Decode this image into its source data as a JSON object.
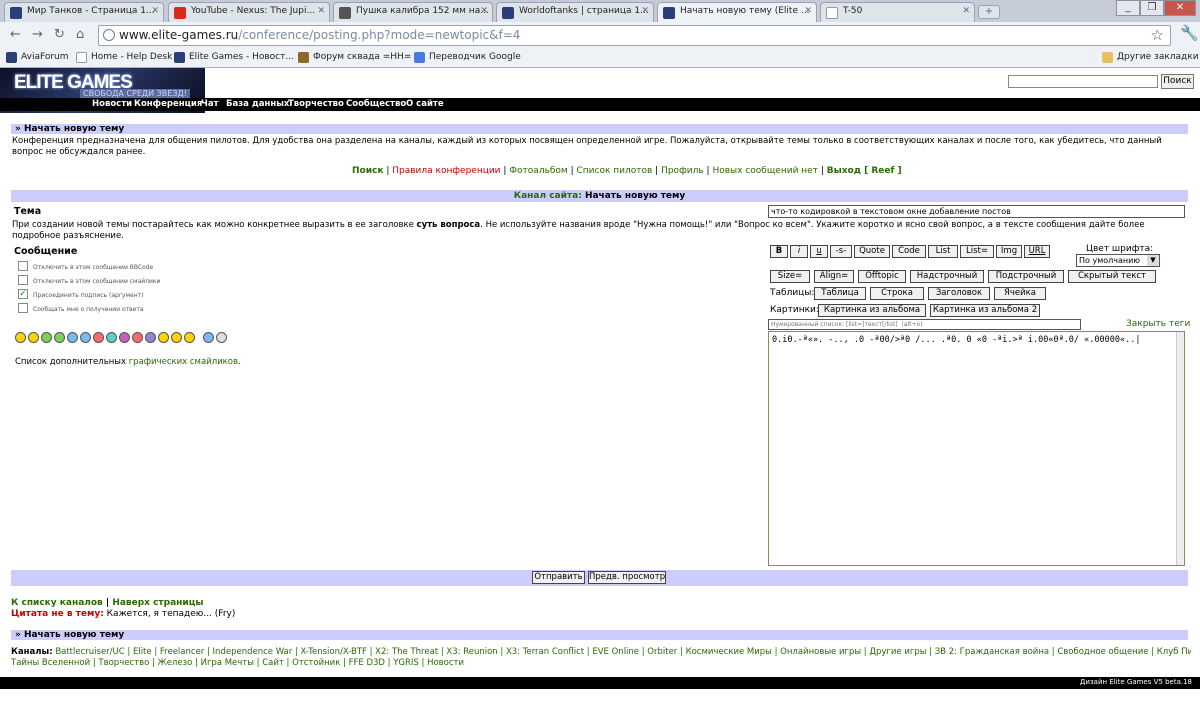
{
  "browser": {
    "tabs": [
      {
        "title": "Мир Танков - Страница 1...",
        "icon_color": "#2a3f7a"
      },
      {
        "title": "YouTube - Nexus: The Jupi...",
        "icon_color": "#d62c1a"
      },
      {
        "title": "Пушка калибра 152 мм на...",
        "icon_color": "#555555"
      },
      {
        "title": "Worldoftanks | страница 1...",
        "icon_color": "#2a3f7a"
      },
      {
        "title": "Начать новую тему (Elite ...",
        "icon_color": "#2a3f7a"
      },
      {
        "title": "T-50",
        "icon_color": "#ffffff"
      }
    ],
    "url_host": "www.elite-games.ru",
    "url_path": "/conference/posting.php?mode=newtopic&f=4",
    "bookmarks": [
      {
        "label": "AviaForum",
        "icon_color": "#2a3f7a"
      },
      {
        "label": "Home - Help Desk",
        "icon_color": "#ffffff"
      },
      {
        "label": "Elite Games - Новост...",
        "icon_color": "#2a3f7a"
      },
      {
        "label": "Форум сквада =HH=",
        "icon_color": "#8a6a2a"
      },
      {
        "label": "Переводчик Google",
        "icon_color": "#4a7adf"
      }
    ],
    "other_bookmarks": "Другие закладки"
  },
  "site": {
    "logo_title": "ELITE GAMES",
    "logo_subtitle": "СВОБОДА СРЕДИ ЗВЕЗД!",
    "search_button": "Поиск",
    "nav": [
      "Новости",
      "Конференция",
      "Чат",
      "База данных",
      "Творчество",
      "Сообщество",
      "О сайте"
    ]
  },
  "page": {
    "bar_title": "» Начать новую тему",
    "intro": "Конференция предназначена для общения пилотов. Для удобства она разделена на каналы, каждый из которых посвящен определенной игре. Пожалуйста, открывайте темы только в соответствующих каналах и после того, как убедитесь, что данный вопрос не обсуждался ранее.",
    "links": {
      "search": "Поиск",
      "rules": "Правила конференции",
      "photo": "Фотоальбом",
      "pilots": "Список пилотов",
      "profile": "Профиль",
      "new_msgs": "Новых сообщений нет",
      "logout": "Выход [ Reef ]"
    },
    "form_header_prefix": "Канал сайта:",
    "form_header_suffix": "Начать новую тему",
    "topic_label": "Тема",
    "topic_value": "что-то кодировкой в текстовом окне добавление постов",
    "topic_hint_a": "При создании новой темы постарайтесь как можно конкретнее выразить в ее заголовке",
    "topic_hint_b": "суть вопроса",
    "topic_hint_c": ". Не используйте названия вроде \"Нужна помощь!\" или \"Вопрос ко всем\". Укажите коротко и ясно свой вопрос, а в тексте сообщения дайте более подробное разъяснение.",
    "message_label": "Сообщение",
    "options": [
      {
        "label": "Отключить в этом сообщении BBCode",
        "checked": false
      },
      {
        "label": "Отключить в этом сообщении смайлики",
        "checked": false
      },
      {
        "label": "Присоединить подпись (аргумент)",
        "checked": true
      },
      {
        "label": "Сообщать мне о получении ответа",
        "checked": false
      }
    ],
    "smiles_prefix": "Список дополнительных",
    "smiles_link": "графических смайликов",
    "font_color_label": "Цвет шрифта:",
    "font_color_value": "По умолчанию",
    "bb_row1": [
      "B",
      "i",
      "u",
      "-s-",
      "Quote",
      "Code",
      "List",
      "List=",
      "Img",
      "URL"
    ],
    "bb_row2": [
      "Size=",
      "Align=",
      "Offtopic",
      "Надстрочный",
      "Подстрочный",
      "Скрытый текст"
    ],
    "tables_label": "Таблицы:",
    "tables_buttons": [
      "Таблица",
      "Строка",
      "Заголовок",
      "Ячейка"
    ],
    "images_label": "Картинки:",
    "images_buttons": [
      "Картинка из альбома",
      "Картинка из альбома 2"
    ],
    "helpline": "Нумерованный список: [list=]текст[/list]  (alt+o)",
    "close_tags": "Закрыть теги",
    "message_text": "0.i0.-ª«». -.., .0 -ª00/>ª0 /... .ª0.  0 «0 -ªi.>ª i.00«0ª.0/ «.00000«..|",
    "submit_button": "Отправить",
    "preview_button": "Предв. просмотр",
    "back_link": "К списку каналов",
    "top_link": "Наверх страницы",
    "quote_label": "Цитата не в тему:",
    "quote_text": "Кажется, я тепадею... (Fry)",
    "bar_title2": "» Начать новую тему",
    "channels_label": "Каналы:",
    "channels_line1": "Battlecruiser/UC | Elite | Freelancer | Independence War | X-Tension/X-BTF | X2: The Threat | X3: Reunion | X3: Terran Conflict | EVE Online | Orbiter | Космические Миры | Онлайновые игры | Другие игры | ЗВ 2: Гражданская война | Свободное общение | Клуб Пилотов |",
    "channels_line2": "Тайны Вселенной | Творчество | Железо | Игра Мечты | Сайт | Отстойник | FFE D3D | YGRIS | Новости",
    "footer": "Дизайн Elite Games V5 beta.18"
  }
}
